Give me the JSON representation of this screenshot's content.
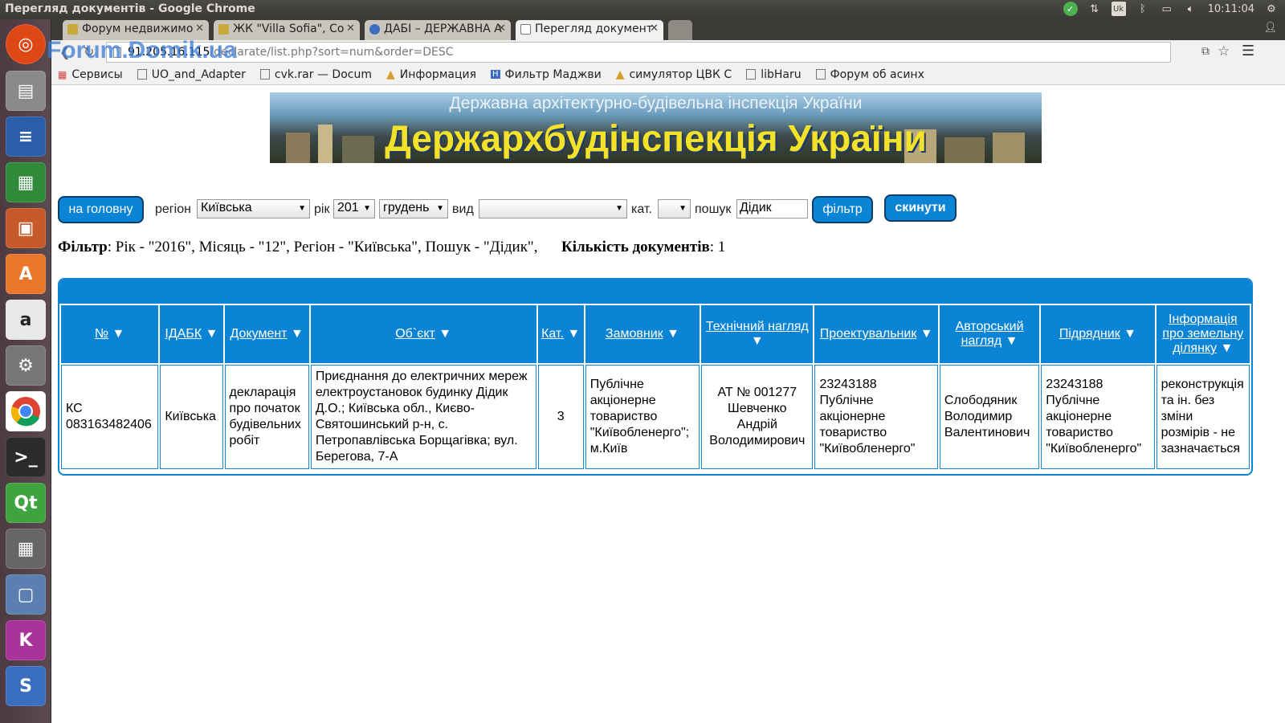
{
  "os": {
    "window_title": "Перегляд документів - Google Chrome",
    "clock": "10:11:04",
    "keyboard_layout": "Uk"
  },
  "browser": {
    "tabs": [
      {
        "label": "Форум недвижимо",
        "icon": "forum-favicon",
        "active": false
      },
      {
        "label": "ЖК \"Villa Sofia\", Со",
        "icon": "forum-favicon",
        "active": false
      },
      {
        "label": "ДАБІ – ДЕРЖАВНА А",
        "icon": "globe-favicon",
        "active": false
      },
      {
        "label": "Перегляд документ",
        "icon": "page-favicon",
        "active": true
      }
    ],
    "url_host": "91.205.16.115",
    "url_path": "/declarate/list.php?sort=num&order=DESC",
    "watermark": "Forum.Domik.ua",
    "bookmarks": [
      "Сервисы",
      "UO_and_Adapter",
      "cvk.rar — Docum",
      "Информация",
      "Фильтр Маджви",
      "симулятор ЦВК С",
      "libHaru",
      "Форум об асинх"
    ]
  },
  "banner": {
    "line1": "Державна архітектурно-будівельна інспекція України",
    "line2": "Держархбудінспекція України"
  },
  "filters": {
    "home_button": "на головну",
    "region_label": "регіон",
    "region_value": "Київська",
    "year_label": "рік",
    "year_value": "201",
    "month_value": "грудень",
    "type_label": "вид",
    "type_value": "",
    "cat_label": "кат.",
    "cat_value": "",
    "search_label": "пошук",
    "search_value": "Дідик",
    "filter_button": "фільтр",
    "reset_button": "скинути"
  },
  "summary": {
    "filter_label": "Фільтр",
    "filter_text": ": Рік - \"2016\", Місяць - \"12\", Регіон - \"Київська\", Пошук - \"Дідик\",",
    "count_label": "Кількість документів",
    "count_value": ": 1"
  },
  "table": {
    "columns": [
      "№",
      "ІДАБК",
      "Документ",
      "Об`єкт",
      "Кат.",
      "Замовник",
      "Технічний нагляд",
      "Проектувальник",
      "Авторський нагляд",
      "Підрядник",
      "Інформація про земельну ділянку"
    ],
    "rows": [
      [
        "КС 083163482406",
        "Київська",
        "декларація про початок будівельних робіт",
        "Приєднання до електричних мереж електроустановок будинку Дідик Д.О.; Київська обл., Києво-Святошинський р-н, с. Петропавлівська Борщагівка; вул. Берегова, 7-А",
        "3",
        "Публічне акціонерне товариство \"Київобленерго\"; м.Київ",
        "АТ № 001277 Шевченко Андрій Володимирович",
        "23243188 Публічне акціонерне товариство \"Київобленерго\"",
        "Слободяник Володимир Валентинович",
        "23243188 Публічне акціонерне товариство \"Київобленерго\"",
        "реконструкція та ін. без зміни розмірів - не зазначається"
      ]
    ]
  }
}
